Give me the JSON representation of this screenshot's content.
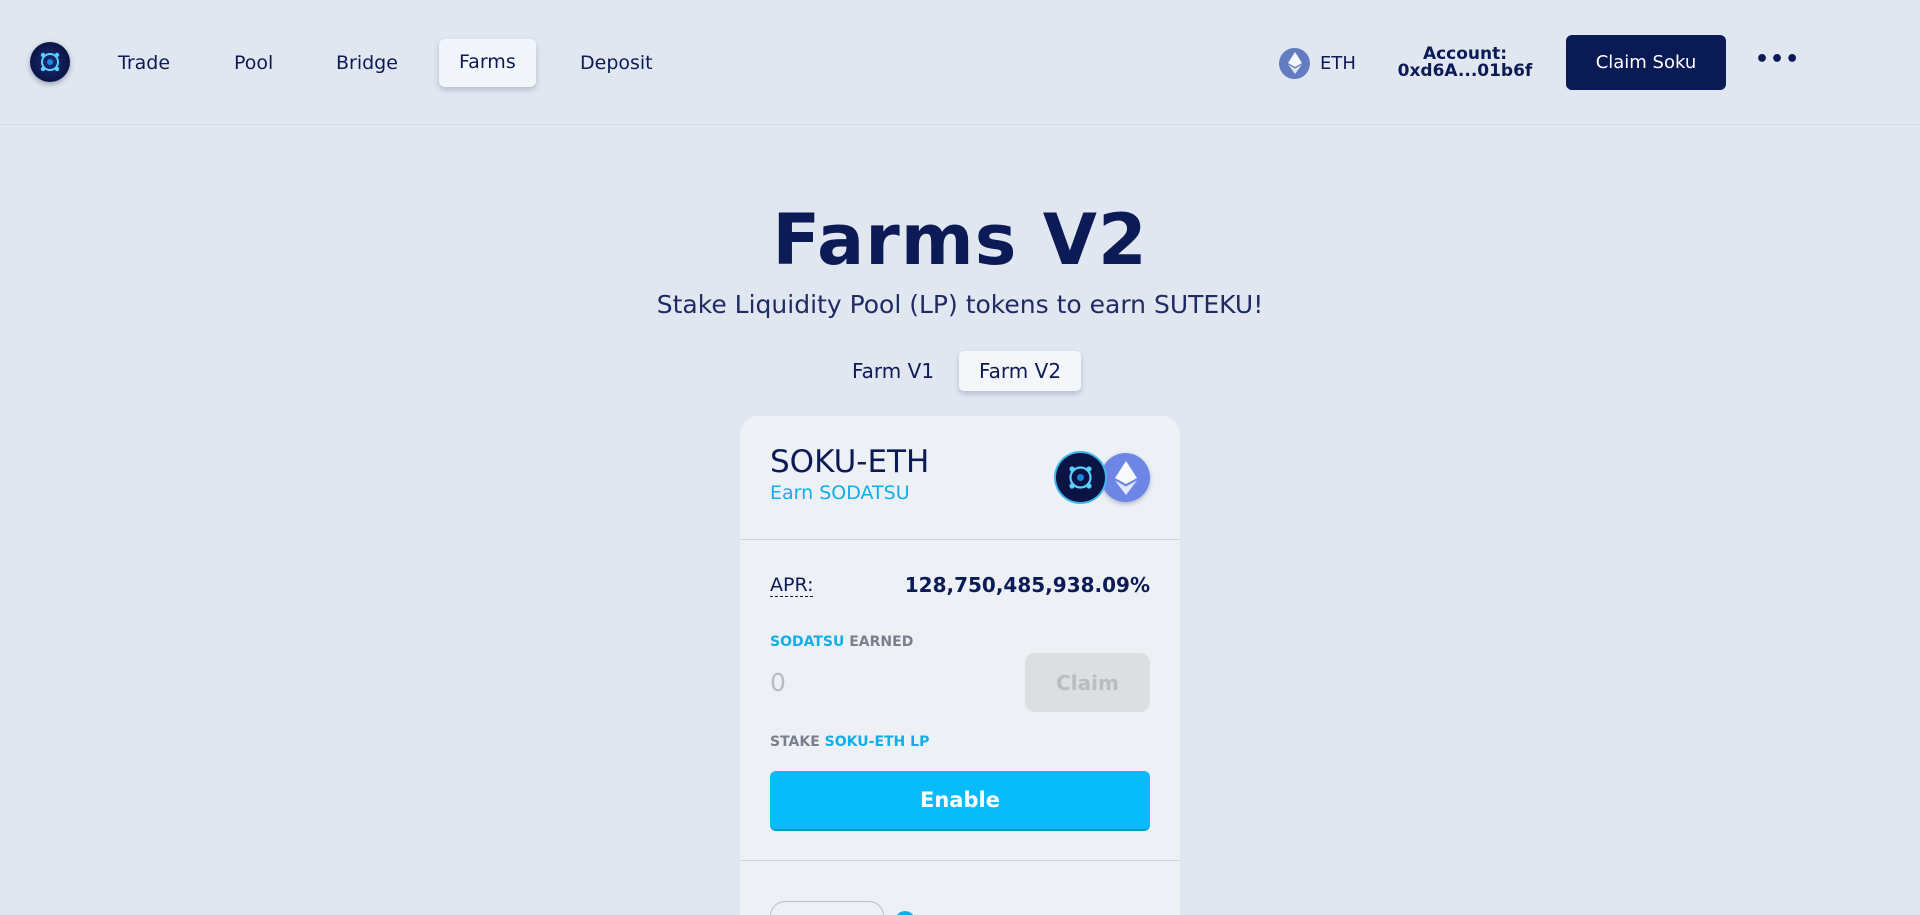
{
  "nav": {
    "links": [
      "Trade",
      "Pool",
      "Bridge",
      "Farms",
      "Deposit"
    ],
    "active": "Farms",
    "chain": "ETH",
    "account_label": "Account:",
    "account_address": "0xd6A...01b6f",
    "claim_button": "Claim Soku",
    "more": "•••"
  },
  "header": {
    "title": "Farms V2",
    "subtitle": "Stake Liquidity Pool (LP) tokens to earn SUTEKU!"
  },
  "tabs": {
    "items": [
      "Farm V1",
      "Farm V2"
    ],
    "active": "Farm V2"
  },
  "farm": {
    "pair": "SOKU-ETH",
    "earn": "Earn SODATSU",
    "apr_label": "APR:",
    "apr_value": "128,750,485,938.09%",
    "earned_token": "SODATSU",
    "earned_word": "EARNED",
    "earned_value": "0",
    "claim_button": "Claim",
    "stake_word": "STAKE",
    "stake_token": "SOKU-ETH LP",
    "enable_button": "Enable"
  },
  "colors": {
    "background": "#e1e7f1",
    "navy": "#0c1a55",
    "accent": "#08bcfb",
    "card": "#edf1f6"
  },
  "icons": {
    "logo": "soku-logo-icon",
    "eth": "ethereum-icon",
    "more": "more-dots-icon"
  }
}
